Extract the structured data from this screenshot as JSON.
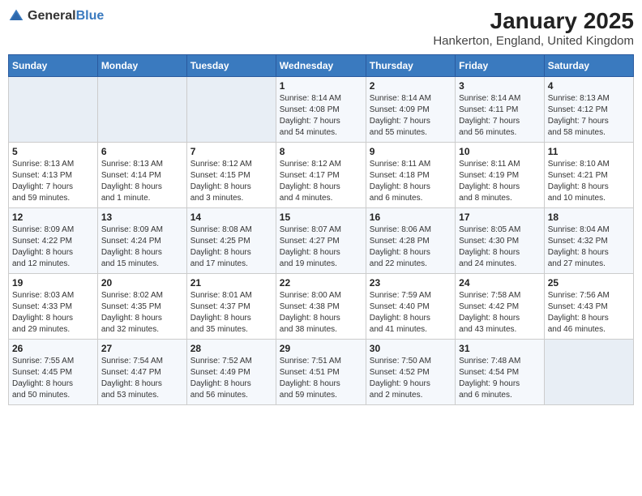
{
  "logo": {
    "general": "General",
    "blue": "Blue"
  },
  "title": "January 2025",
  "subtitle": "Hankerton, England, United Kingdom",
  "days_of_week": [
    "Sunday",
    "Monday",
    "Tuesday",
    "Wednesday",
    "Thursday",
    "Friday",
    "Saturday"
  ],
  "weeks": [
    [
      {
        "day": "",
        "content": ""
      },
      {
        "day": "",
        "content": ""
      },
      {
        "day": "",
        "content": ""
      },
      {
        "day": "1",
        "content": "Sunrise: 8:14 AM\nSunset: 4:08 PM\nDaylight: 7 hours\nand 54 minutes."
      },
      {
        "day": "2",
        "content": "Sunrise: 8:14 AM\nSunset: 4:09 PM\nDaylight: 7 hours\nand 55 minutes."
      },
      {
        "day": "3",
        "content": "Sunrise: 8:14 AM\nSunset: 4:11 PM\nDaylight: 7 hours\nand 56 minutes."
      },
      {
        "day": "4",
        "content": "Sunrise: 8:13 AM\nSunset: 4:12 PM\nDaylight: 7 hours\nand 58 minutes."
      }
    ],
    [
      {
        "day": "5",
        "content": "Sunrise: 8:13 AM\nSunset: 4:13 PM\nDaylight: 7 hours\nand 59 minutes."
      },
      {
        "day": "6",
        "content": "Sunrise: 8:13 AM\nSunset: 4:14 PM\nDaylight: 8 hours\nand 1 minute."
      },
      {
        "day": "7",
        "content": "Sunrise: 8:12 AM\nSunset: 4:15 PM\nDaylight: 8 hours\nand 3 minutes."
      },
      {
        "day": "8",
        "content": "Sunrise: 8:12 AM\nSunset: 4:17 PM\nDaylight: 8 hours\nand 4 minutes."
      },
      {
        "day": "9",
        "content": "Sunrise: 8:11 AM\nSunset: 4:18 PM\nDaylight: 8 hours\nand 6 minutes."
      },
      {
        "day": "10",
        "content": "Sunrise: 8:11 AM\nSunset: 4:19 PM\nDaylight: 8 hours\nand 8 minutes."
      },
      {
        "day": "11",
        "content": "Sunrise: 8:10 AM\nSunset: 4:21 PM\nDaylight: 8 hours\nand 10 minutes."
      }
    ],
    [
      {
        "day": "12",
        "content": "Sunrise: 8:09 AM\nSunset: 4:22 PM\nDaylight: 8 hours\nand 12 minutes."
      },
      {
        "day": "13",
        "content": "Sunrise: 8:09 AM\nSunset: 4:24 PM\nDaylight: 8 hours\nand 15 minutes."
      },
      {
        "day": "14",
        "content": "Sunrise: 8:08 AM\nSunset: 4:25 PM\nDaylight: 8 hours\nand 17 minutes."
      },
      {
        "day": "15",
        "content": "Sunrise: 8:07 AM\nSunset: 4:27 PM\nDaylight: 8 hours\nand 19 minutes."
      },
      {
        "day": "16",
        "content": "Sunrise: 8:06 AM\nSunset: 4:28 PM\nDaylight: 8 hours\nand 22 minutes."
      },
      {
        "day": "17",
        "content": "Sunrise: 8:05 AM\nSunset: 4:30 PM\nDaylight: 8 hours\nand 24 minutes."
      },
      {
        "day": "18",
        "content": "Sunrise: 8:04 AM\nSunset: 4:32 PM\nDaylight: 8 hours\nand 27 minutes."
      }
    ],
    [
      {
        "day": "19",
        "content": "Sunrise: 8:03 AM\nSunset: 4:33 PM\nDaylight: 8 hours\nand 29 minutes."
      },
      {
        "day": "20",
        "content": "Sunrise: 8:02 AM\nSunset: 4:35 PM\nDaylight: 8 hours\nand 32 minutes."
      },
      {
        "day": "21",
        "content": "Sunrise: 8:01 AM\nSunset: 4:37 PM\nDaylight: 8 hours\nand 35 minutes."
      },
      {
        "day": "22",
        "content": "Sunrise: 8:00 AM\nSunset: 4:38 PM\nDaylight: 8 hours\nand 38 minutes."
      },
      {
        "day": "23",
        "content": "Sunrise: 7:59 AM\nSunset: 4:40 PM\nDaylight: 8 hours\nand 41 minutes."
      },
      {
        "day": "24",
        "content": "Sunrise: 7:58 AM\nSunset: 4:42 PM\nDaylight: 8 hours\nand 43 minutes."
      },
      {
        "day": "25",
        "content": "Sunrise: 7:56 AM\nSunset: 4:43 PM\nDaylight: 8 hours\nand 46 minutes."
      }
    ],
    [
      {
        "day": "26",
        "content": "Sunrise: 7:55 AM\nSunset: 4:45 PM\nDaylight: 8 hours\nand 50 minutes."
      },
      {
        "day": "27",
        "content": "Sunrise: 7:54 AM\nSunset: 4:47 PM\nDaylight: 8 hours\nand 53 minutes."
      },
      {
        "day": "28",
        "content": "Sunrise: 7:52 AM\nSunset: 4:49 PM\nDaylight: 8 hours\nand 56 minutes."
      },
      {
        "day": "29",
        "content": "Sunrise: 7:51 AM\nSunset: 4:51 PM\nDaylight: 8 hours\nand 59 minutes."
      },
      {
        "day": "30",
        "content": "Sunrise: 7:50 AM\nSunset: 4:52 PM\nDaylight: 9 hours\nand 2 minutes."
      },
      {
        "day": "31",
        "content": "Sunrise: 7:48 AM\nSunset: 4:54 PM\nDaylight: 9 hours\nand 6 minutes."
      },
      {
        "day": "",
        "content": ""
      }
    ]
  ]
}
